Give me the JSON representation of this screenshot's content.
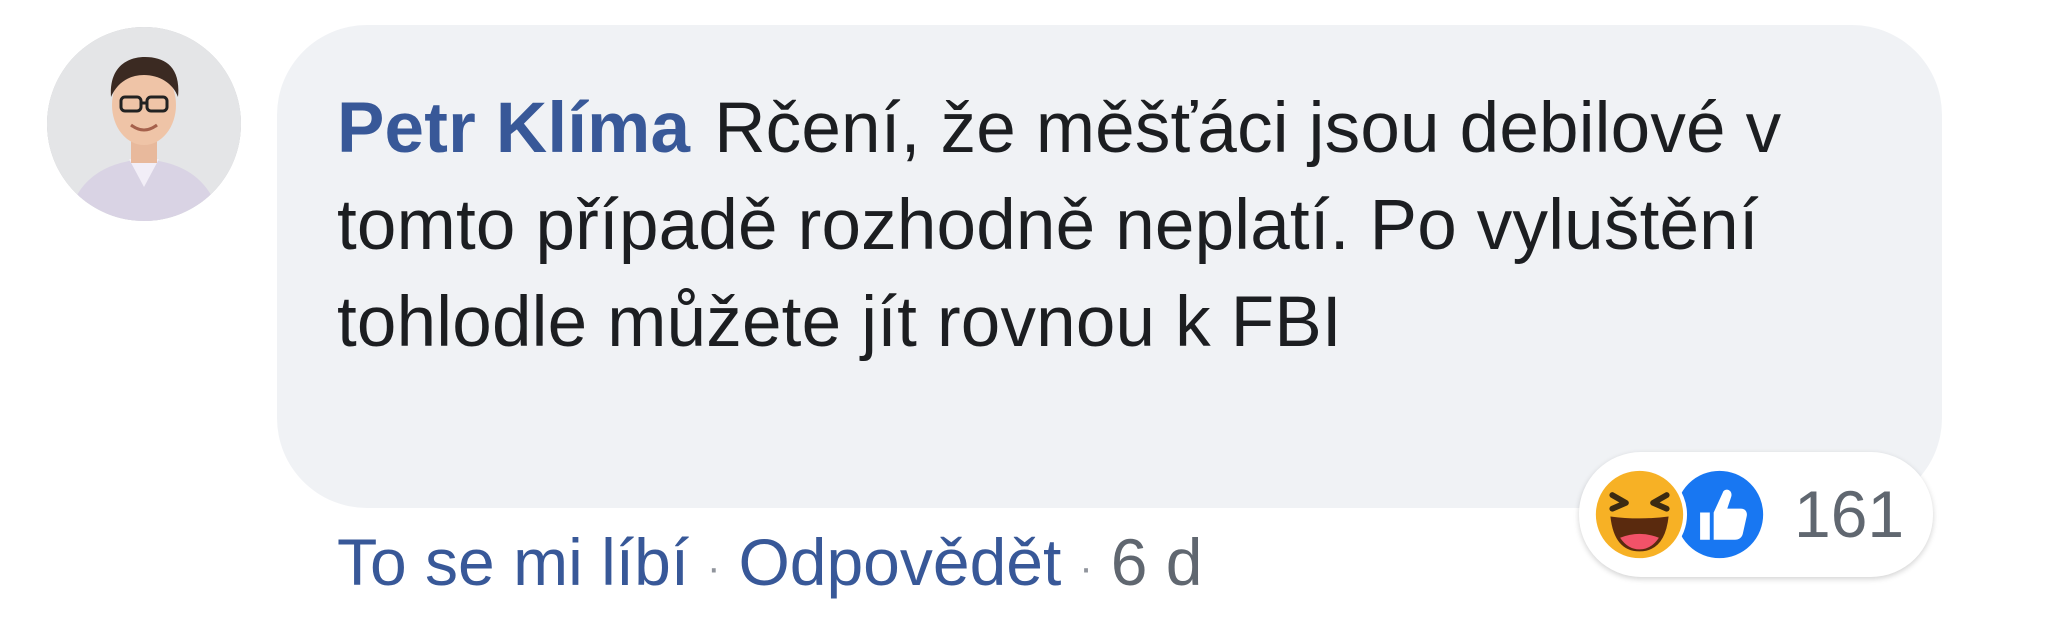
{
  "comment": {
    "author": "Petr Klíma",
    "text": "Rčení, že měšťáci jsou debilové v tomto případě rozhodně neplatí. Po vyluštění tohlodle můžete jít rovnou k FBI"
  },
  "actions": {
    "like_label": "To se mi líbí",
    "separator": "·",
    "reply_label": "Odpovědět",
    "timestamp": "6 d"
  },
  "reactions": {
    "icons": [
      "haha-emoji-icon",
      "like-thumb-icon"
    ],
    "count": "161"
  },
  "colors": {
    "link": "#385898",
    "bubble": "#f0f2f5",
    "text": "#1c1e21",
    "meta": "#606770",
    "like_blue": "#1877f2",
    "haha_yellow": "#f7b125"
  }
}
